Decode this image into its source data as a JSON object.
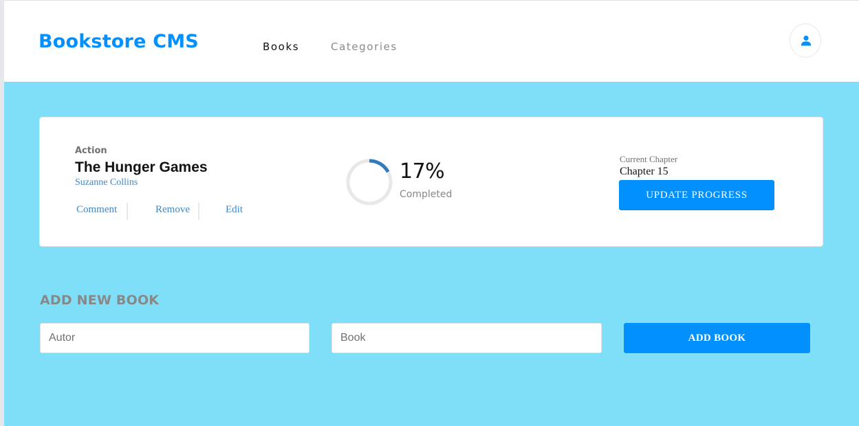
{
  "header": {
    "logo": "Bookstore CMS",
    "nav": [
      {
        "label": "Books",
        "active": true
      },
      {
        "label": "Categories",
        "active": false
      }
    ],
    "avatar_icon": "user-icon"
  },
  "book": {
    "genre": "Action",
    "title": "The Hunger Games",
    "author": "Suzanne Collins",
    "actions": [
      "Comment",
      "Remove",
      "Edit"
    ],
    "progress": {
      "percent": 17,
      "percent_label": "17%",
      "status": "Completed"
    },
    "chapter": {
      "label": "Current Chapter",
      "value": "Chapter 15"
    },
    "update_button": "UPDATE PROGRESS"
  },
  "add_form": {
    "title": "ADD NEW BOOK",
    "author_placeholder": "Autor",
    "book_placeholder": "Book",
    "submit": "ADD BOOK"
  },
  "colors": {
    "brand": "#0290ff",
    "background": "#7fdff8",
    "link": "#4386bf",
    "progress": "#307bbe",
    "progress_track": "#e8e8e8"
  }
}
